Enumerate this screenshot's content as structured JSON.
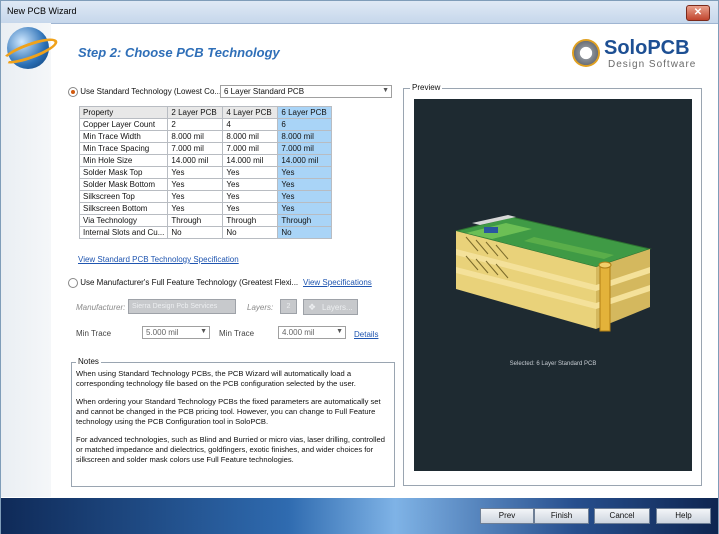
{
  "window": {
    "title": "New PCB Wizard",
    "close_glyph": "✕"
  },
  "header": {
    "step_title": "Step 2: Choose PCB Technology",
    "brand_name": "SoloPCB",
    "brand_tagline": "Design Software"
  },
  "standard": {
    "radio_label": "Use Standard Technology (Lowest Co...",
    "selected": true,
    "combo_value": "6 Layer Standard PCB",
    "table": {
      "headers": [
        "Property",
        "2 Layer PCB",
        "4 Layer PCB",
        "6 Layer PCB"
      ],
      "rows": [
        [
          "Copper Layer Count",
          "2",
          "4",
          "6"
        ],
        [
          "Min Trace Width",
          "8.000 mil",
          "8.000 mil",
          "8.000 mil"
        ],
        [
          "Min Trace Spacing",
          "7.000 mil",
          "7.000 mil",
          "7.000 mil"
        ],
        [
          "Min Hole Size",
          "14.000 mil",
          "14.000 mil",
          "14.000 mil"
        ],
        [
          "Solder Mask Top",
          "Yes",
          "Yes",
          "Yes"
        ],
        [
          "Solder Mask Bottom",
          "Yes",
          "Yes",
          "Yes"
        ],
        [
          "Silkscreen Top",
          "Yes",
          "Yes",
          "Yes"
        ],
        [
          "Silkscreen Bottom",
          "Yes",
          "Yes",
          "Yes"
        ],
        [
          "Via Technology",
          "Through",
          "Through",
          "Through"
        ],
        [
          "Internal Slots and Cu...",
          "No",
          "No",
          "No"
        ]
      ]
    },
    "spec_link": "View Standard PCB Technology Specification"
  },
  "full": {
    "radio_label": "Use Manufacturer's Full Feature Technology (Greatest Flexi...",
    "selected": false,
    "spec_link": "View Specifications",
    "manufacturer_label": "Manufacturer:",
    "manufacturer_value": "Sierra Design Pcb Services",
    "layers_label": "Layers:",
    "layers_value": "2",
    "layers_button": "Layers...",
    "min_trace_label": "Min Trace",
    "min_trace_value": "5.000 mil",
    "min_trace2_label": "Min Trace",
    "min_trace2_value": "4.000 mil",
    "details_link": "Details"
  },
  "notes": {
    "legend": "Notes",
    "p1": "When using Standard Technology PCBs, the PCB Wizard will automatically load a corresponding technology file based on the PCB configuration selected by the user.",
    "p2": "When ordering your Standard Technology PCBs the fixed parameters are automatically set and cannot be changed in the PCB pricing tool. However, you can change to Full Feature technology using the PCB Configuration tool in SoloPCB.",
    "p3": "For advanced technologies, such as Blind and Burried or micro vias, laser drilling, controlled or matched impedance and dielectrics, goldfingers, exotic finishes, and wider choices for silkscreen and solder mask colors use Full Feature technologies."
  },
  "preview": {
    "legend": "Preview",
    "caption": "Selected: 6 Layer Standard PCB"
  },
  "buttons": {
    "prev": "Prev",
    "finish": "Finish",
    "cancel": "Cancel",
    "help": "Help"
  }
}
